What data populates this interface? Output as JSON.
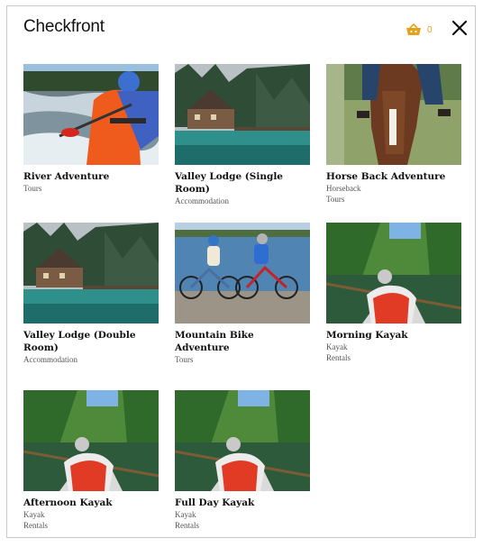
{
  "header": {
    "brand": "Checkfront",
    "cart_count": "0"
  },
  "products": [
    {
      "title": "River Adventure",
      "categories": [
        "Tours"
      ],
      "image": "river-adventure"
    },
    {
      "title": "Valley Lodge (Single Room)",
      "categories": [
        "Accommodation"
      ],
      "image": "valley-lodge"
    },
    {
      "title": "Horse Back Adventure",
      "categories": [
        "Horseback",
        "Tours"
      ],
      "image": "horse"
    },
    {
      "title": "Valley Lodge (Double Room)",
      "categories": [
        "Accommodation"
      ],
      "image": "valley-lodge"
    },
    {
      "title": "Mountain Bike Adventure",
      "categories": [
        "Tours"
      ],
      "image": "bikes"
    },
    {
      "title": "Morning Kayak",
      "categories": [
        "Kayak",
        "Rentals"
      ],
      "image": "kayak"
    },
    {
      "title": "Afternoon Kayak",
      "categories": [
        "Kayak",
        "Rentals"
      ],
      "image": "kayak"
    },
    {
      "title": "Full Day Kayak",
      "categories": [
        "Kayak",
        "Rentals"
      ],
      "image": "kayak"
    }
  ],
  "colors": {
    "accent": "#e3a21a",
    "title": "#111111",
    "sub": "#555555"
  }
}
